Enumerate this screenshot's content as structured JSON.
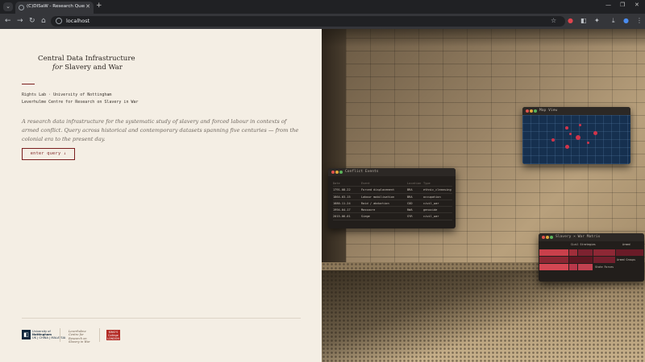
{
  "browser": {
    "tab_title": "(C)DISaW - Research Query Inte",
    "url": "localhost",
    "tab_menu_icon": "chevron-down-icon",
    "new_tab_icon": "plus-icon"
  },
  "brand": {
    "title": "Central Data Infrastructure",
    "subtitle_italic": "for",
    "subtitle_rest": " Slavery and War"
  },
  "affiliation": {
    "line1": "Rights Lab · University of Nottingham",
    "line2": "Leverhulme Centre for Research on Slavery in War"
  },
  "lede": "A research data infrastructure for the systematic study of slavery and forced labour in contexts of armed conflict. Query across historical and contemporary datasets spanning five centuries — from the colonial era to the present day.",
  "cta_label": "enter query ↓",
  "footer": {
    "uon_mark": "◧",
    "uon_line1": "University of",
    "uon_line2": "Nottingham",
    "uon_line3": "UK | CHINA | MALAYSIA",
    "rights_lines": [
      "Leverhulme",
      "Centre for",
      "Research on",
      "Slavery in War"
    ],
    "red_logo_lines": [
      "KING'S",
      "College",
      "LONDON"
    ]
  },
  "windows": {
    "map_title": "Map View",
    "events_title": "Conflict Events",
    "heat_title": "Slavery × War Matrix",
    "events_columns": [
      "Date",
      "Event",
      "Location",
      "Type"
    ],
    "events_rows": [
      [
        "1791-08-22",
        "Forced displacement",
        "BRA",
        "ethnic_cleansing"
      ],
      [
        "1864-03-15",
        "Labour mobilisation",
        "BRA",
        "occupation"
      ],
      [
        "1880-11-24",
        "Raid / abduction",
        "COD",
        "civil_war"
      ],
      [
        "1994-04-17",
        "Massacre",
        "RWA",
        "genocide"
      ],
      [
        "2015-06-01",
        "Siege",
        "SYR",
        "civil_war"
      ]
    ],
    "heat_labels": [
      "Civil Strategies",
      "Armed",
      "Armed Groups",
      "State Forces"
    ]
  },
  "colors": {
    "accent": "#7a1e1e",
    "page_bg": "#f4eee4",
    "map_bg": "#16304f",
    "marker": "#d2344a"
  }
}
